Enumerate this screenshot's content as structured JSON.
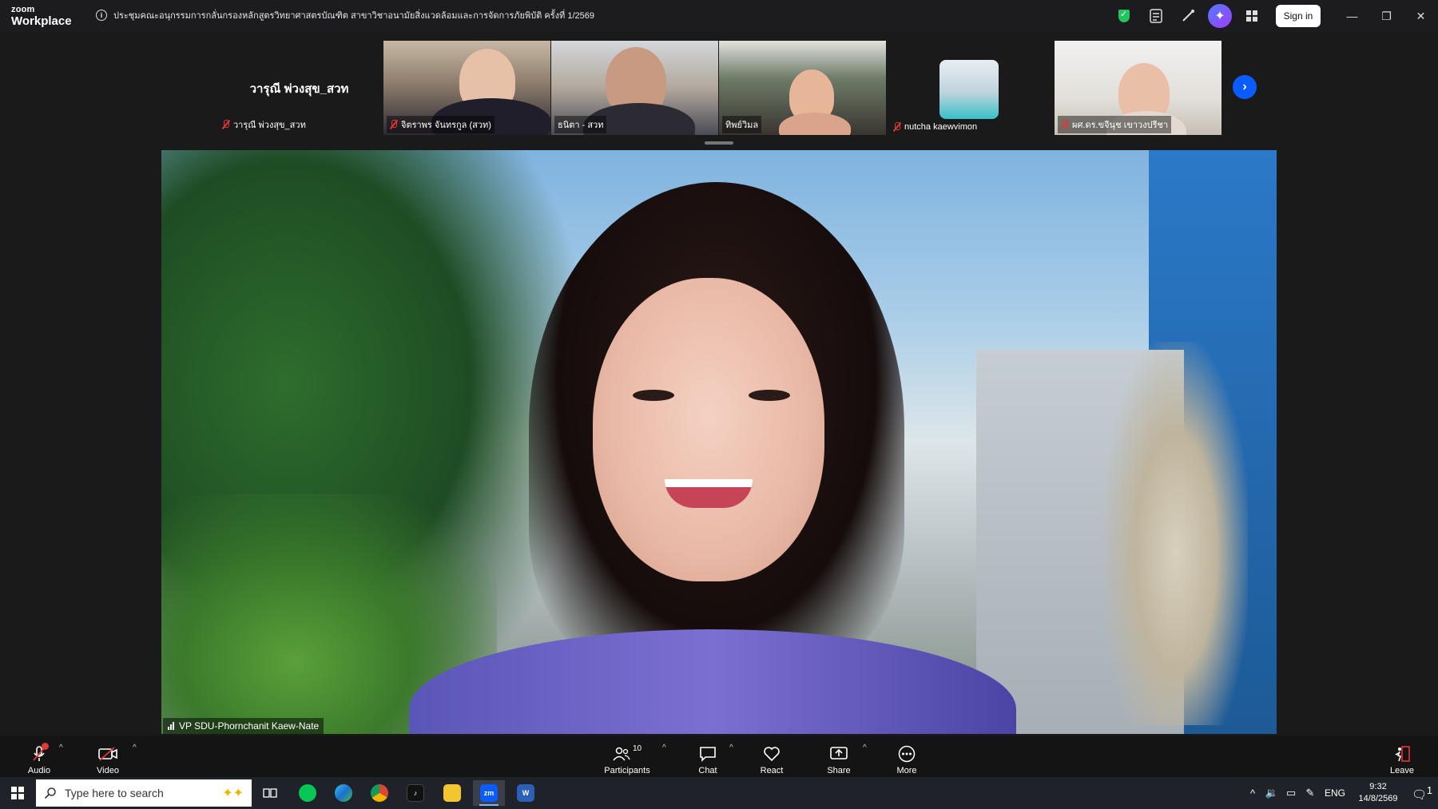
{
  "titlebar": {
    "brand_top": "zoom",
    "brand_bottom": "Workplace",
    "meeting_title": "ประชุมคณะอนุกรรมการกลั่นกรองหลักสูตรวิทยาศาสตรบัณฑิต สาขาวิชาอนามัยสิ่งแวดล้อมและการจัดการภัยพิบัติ ครั้งที่ 1/2569",
    "sign_in": "Sign in",
    "ai_icon": "✦",
    "minimize": "—",
    "restore": "❐",
    "close": "✕"
  },
  "participants_strip": [
    {
      "name": "วารุณี พ่วงสุข_สวท",
      "big_name": "วารุณี พ่วงสุข_สวท",
      "muted": true
    },
    {
      "name": "จิตราพร จันทรกูล (สวท)",
      "muted": true
    },
    {
      "name": "ธนิตา - สวท",
      "muted": false
    },
    {
      "name": "ทิพย์วิมล",
      "muted": false
    },
    {
      "name": "nutcha kaewvimon",
      "muted": true
    },
    {
      "name": "ผศ.ดร.ขจีนุช เขาวงปรีชา",
      "muted": true
    }
  ],
  "strip_next": "›",
  "main_video": {
    "speaker_name": "VP SDU-Phornchanit Kaew-Nate"
  },
  "toolbar": {
    "audio": "Audio",
    "video": "Video",
    "participants": "Participants",
    "participants_count": "10",
    "chat": "Chat",
    "react": "React",
    "share": "Share",
    "more": "More",
    "leave": "Leave",
    "caret": "^"
  },
  "taskbar": {
    "search_placeholder": "Type here to search",
    "apps": [
      "LINE",
      "Edge",
      "Chrome",
      "TikTok",
      "File Explorer",
      "zm",
      "Word"
    ],
    "zoom_label": "zm",
    "word_label": "W",
    "lang": "ENG",
    "time": "9:32",
    "date": "14/8/2569",
    "notifications": "1"
  },
  "colors": {
    "accent": "#0b5cff",
    "muted_red": "#e23838",
    "shield_green": "#22c55e"
  }
}
